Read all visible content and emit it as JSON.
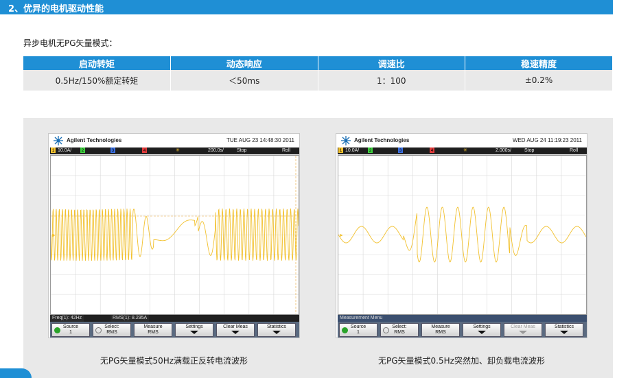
{
  "section": {
    "title": "2、优异的电机驱动性能"
  },
  "intro": "异步电机无PG矢量模式：",
  "table": {
    "headers": [
      "启动转矩",
      "动态响应",
      "调速比",
      "稳速精度"
    ],
    "row": [
      "0.5Hz/150%额定转矩",
      "＜50ms",
      "1：100",
      "±0.2%"
    ]
  },
  "scopes": [
    {
      "brand": "Agilent Technologies",
      "timestamp": "TUE AUG 23 14:48:30 2011",
      "status": {
        "ch1": "10.0A/",
        "ch_labels": [
          "1",
          "2",
          "3",
          "4"
        ],
        "timebase": "200.0s/",
        "state": "Stop",
        "mode": "Roll"
      },
      "readout": {
        "freq": "Freq(1): 42Hz",
        "rms": "RMS(1): 8.295A",
        "menu": ""
      },
      "softkeys": [
        {
          "line1": "Source",
          "line2": "1"
        },
        {
          "line1": "Select:",
          "line2": "RMS"
        },
        {
          "line1": "Measure",
          "line2": "RMS"
        },
        {
          "line1": "Settings",
          "line2": ""
        },
        {
          "line1": "Clear Meas",
          "line2": ""
        },
        {
          "line1": "Statistics",
          "line2": ""
        }
      ],
      "caption": "无PG矢量模式50Hz满载正反转电流波形"
    },
    {
      "brand": "Agilent Technologies",
      "timestamp": "WED AUG 24 11:19:23 2011",
      "status": {
        "ch1": "10.0A/",
        "ch_labels": [
          "1",
          "2",
          "3",
          "4"
        ],
        "timebase": "2.000s/",
        "state": "Stop",
        "mode": "Roll"
      },
      "readout": {
        "freq": "",
        "rms": "",
        "menu": "Measurement Menu"
      },
      "softkeys": [
        {
          "line1": "Source",
          "line2": "1"
        },
        {
          "line1": "Select:",
          "line2": "RMS"
        },
        {
          "line1": "Measure",
          "line2": "RMS"
        },
        {
          "line1": "Settings",
          "line2": ""
        },
        {
          "line1": "Clear Meas",
          "line2": ""
        },
        {
          "line1": "Statistics",
          "line2": ""
        }
      ],
      "caption": "无PG矢量模式0.5Hz突然加、卸负载电流波形"
    }
  ],
  "colors": {
    "accent": "#1f8fd5",
    "trace": "#f2c12e",
    "panel": "#e9e9e9"
  }
}
